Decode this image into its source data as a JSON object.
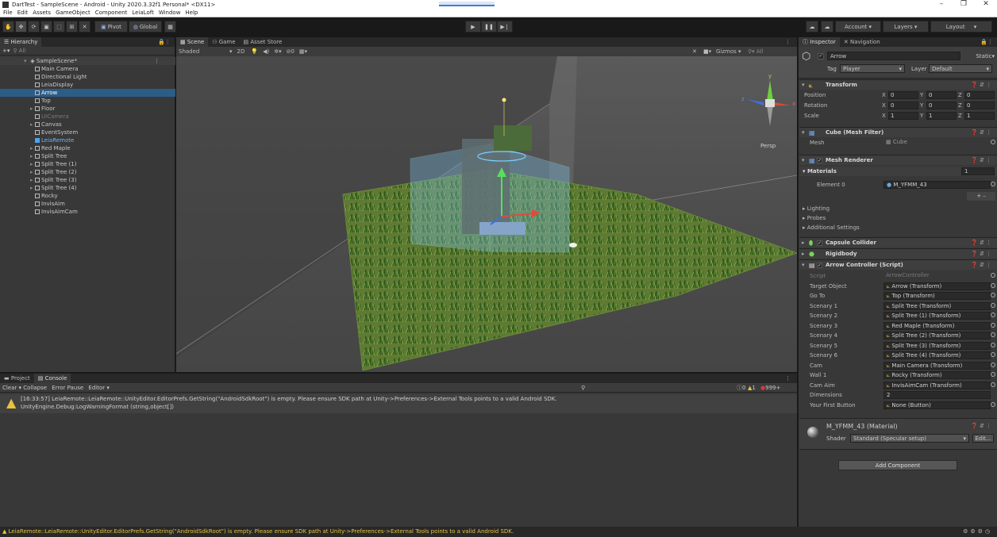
{
  "window": {
    "title": "DartTest - SampleScene - Android - Unity 2020.3.32f1 Personal* <DX11>",
    "controls": [
      "–",
      "❐",
      "✕"
    ]
  },
  "menu": [
    "File",
    "Edit",
    "Assets",
    "GameObject",
    "Component",
    "LeiaLoft",
    "Window",
    "Help"
  ],
  "toolbar": {
    "pivot": "Pivot",
    "global": "Global",
    "account": "Account",
    "layers": "Layers",
    "layout": "Layout"
  },
  "hierarchy": {
    "tab": "Hierarchy",
    "search_placeholder": "All",
    "scene": "SampleScene*",
    "items": [
      {
        "label": "Main Camera",
        "indent": 2,
        "expandable": false,
        "selected": false
      },
      {
        "label": "Directional Light",
        "indent": 2,
        "expandable": false,
        "selected": false
      },
      {
        "label": "LeiaDisplay",
        "indent": 2,
        "expandable": false,
        "selected": false
      },
      {
        "label": "Arrow",
        "indent": 2,
        "expandable": false,
        "selected": true
      },
      {
        "label": "Top",
        "indent": 2,
        "expandable": false,
        "selected": false
      },
      {
        "label": "Floor",
        "indent": 2,
        "expandable": true,
        "selected": false
      },
      {
        "label": "UICamera",
        "indent": 2,
        "expandable": false,
        "selected": false,
        "dim": true
      },
      {
        "label": "Canvas",
        "indent": 2,
        "expandable": true,
        "selected": false
      },
      {
        "label": "EventSystem",
        "indent": 2,
        "expandable": false,
        "selected": false
      },
      {
        "label": "LeiaRemote",
        "indent": 2,
        "expandable": false,
        "selected": false,
        "blue": true
      },
      {
        "label": "Red Maple",
        "indent": 2,
        "expandable": true,
        "selected": false
      },
      {
        "label": "Split Tree",
        "indent": 2,
        "expandable": true,
        "selected": false
      },
      {
        "label": "Split Tree (1)",
        "indent": 2,
        "expandable": true,
        "selected": false
      },
      {
        "label": "Split Tree (2)",
        "indent": 2,
        "expandable": true,
        "selected": false
      },
      {
        "label": "Split Tree (3)",
        "indent": 2,
        "expandable": true,
        "selected": false
      },
      {
        "label": "Split Tree (4)",
        "indent": 2,
        "expandable": true,
        "selected": false
      },
      {
        "label": "Rocky",
        "indent": 2,
        "expandable": false,
        "selected": false
      },
      {
        "label": "InvisAim",
        "indent": 2,
        "expandable": false,
        "selected": false
      },
      {
        "label": "InvisAimCam",
        "indent": 2,
        "expandable": false,
        "selected": false
      }
    ]
  },
  "scene": {
    "tabs": [
      "Scene",
      "Game",
      "Asset Store"
    ],
    "shading": "Shaded",
    "mode2d": "2D",
    "gizmos": "Gizmos",
    "search_placeholder": "All",
    "persp": "Persp"
  },
  "inspector": {
    "tabs": [
      "Inspector",
      "Navigation"
    ],
    "object_name": "Arrow",
    "static_label": "Static",
    "tag_label": "Tag",
    "tag_value": "Player",
    "layer_label": "Layer",
    "layer_value": "Default",
    "transform": {
      "title": "Transform",
      "position_label": "Position",
      "position": [
        "0",
        "0",
        "0"
      ],
      "rotation_label": "Rotation",
      "rotation": [
        "0",
        "0",
        "0"
      ],
      "scale_label": "Scale",
      "scale": [
        "1",
        "1",
        "1"
      ]
    },
    "mesh_filter": {
      "title": "Cube (Mesh Filter)",
      "mesh_label": "Mesh",
      "mesh_value": "Cube"
    },
    "mesh_renderer": {
      "title": "Mesh Renderer",
      "materials_label": "Materials",
      "materials_count": "1",
      "element_label": "Element 0",
      "element_value": "M_YFMM_43",
      "add_remove": "+  –",
      "lighting": "Lighting",
      "probes": "Probes",
      "additional": "Additional Settings"
    },
    "capsule_collider": "Capsule Collider",
    "rigidbody": "Rigidbody",
    "arrow_controller": {
      "title": "Arrow Controller (Script)",
      "fields": [
        {
          "label": "Script",
          "value": "ArrowController",
          "dim": true
        },
        {
          "label": "Target Object",
          "value": "Arrow (Transform)"
        },
        {
          "label": "Go To",
          "value": "Top (Transform)"
        },
        {
          "label": "Scenary 1",
          "value": "Split Tree (Transform)"
        },
        {
          "label": "Scenary 2",
          "value": "Split Tree (1) (Transform)"
        },
        {
          "label": "Scenary 3",
          "value": "Red Maple (Transform)"
        },
        {
          "label": "Scenary 4",
          "value": "Split Tree (2) (Transform)"
        },
        {
          "label": "Scenary 5",
          "value": "Split Tree (3) (Transform)"
        },
        {
          "label": "Scenary 6",
          "value": "Split Tree (4) (Transform)"
        },
        {
          "label": "Cam",
          "value": "Main Camera (Transform)"
        },
        {
          "label": "Wall 1",
          "value": "Rocky (Transform)"
        },
        {
          "label": "Cam Aim",
          "value": "InvisAimCam (Transform)"
        },
        {
          "label": "Dimensions",
          "value": "2",
          "nocirc": true
        },
        {
          "label": "Your First Button",
          "value": "None (Button)"
        }
      ]
    },
    "material": {
      "title": "M_YFMM_43 (Material)",
      "shader_label": "Shader",
      "shader_value": "Standard (Specular setup)",
      "edit": "Edit..."
    },
    "add_component": "Add Component"
  },
  "console": {
    "tabs": [
      "Project",
      "Console"
    ],
    "buttons": [
      "Clear",
      "Collapse",
      "Error Pause",
      "Editor"
    ],
    "counts": {
      "log": "0",
      "warn": "1",
      "error": "999+"
    },
    "entry_line1": "[16:33:57] LeiaRemote::LeiaRemote::UnityEditor.EditorPrefs.GetString(\"AndroidSdkRoot\") is empty. Please ensure SDK path at Unity->Preferences->External Tools points to a valid Android SDK.",
    "entry_line2": "UnityEngine.Debug:LogWarningFormat (string,object[])"
  },
  "status": "LeiaRemote::LeiaRemote::UnityEditor.EditorPrefs.GetString(\"AndroidSdkRoot\") is empty. Please ensure SDK path at Unity->Preferences->External Tools points to a valid Android SDK.",
  "colors": {
    "selection": "#2c5d87",
    "warning": "#e9c23e",
    "error": "#d23a3a",
    "panel": "#383838"
  }
}
